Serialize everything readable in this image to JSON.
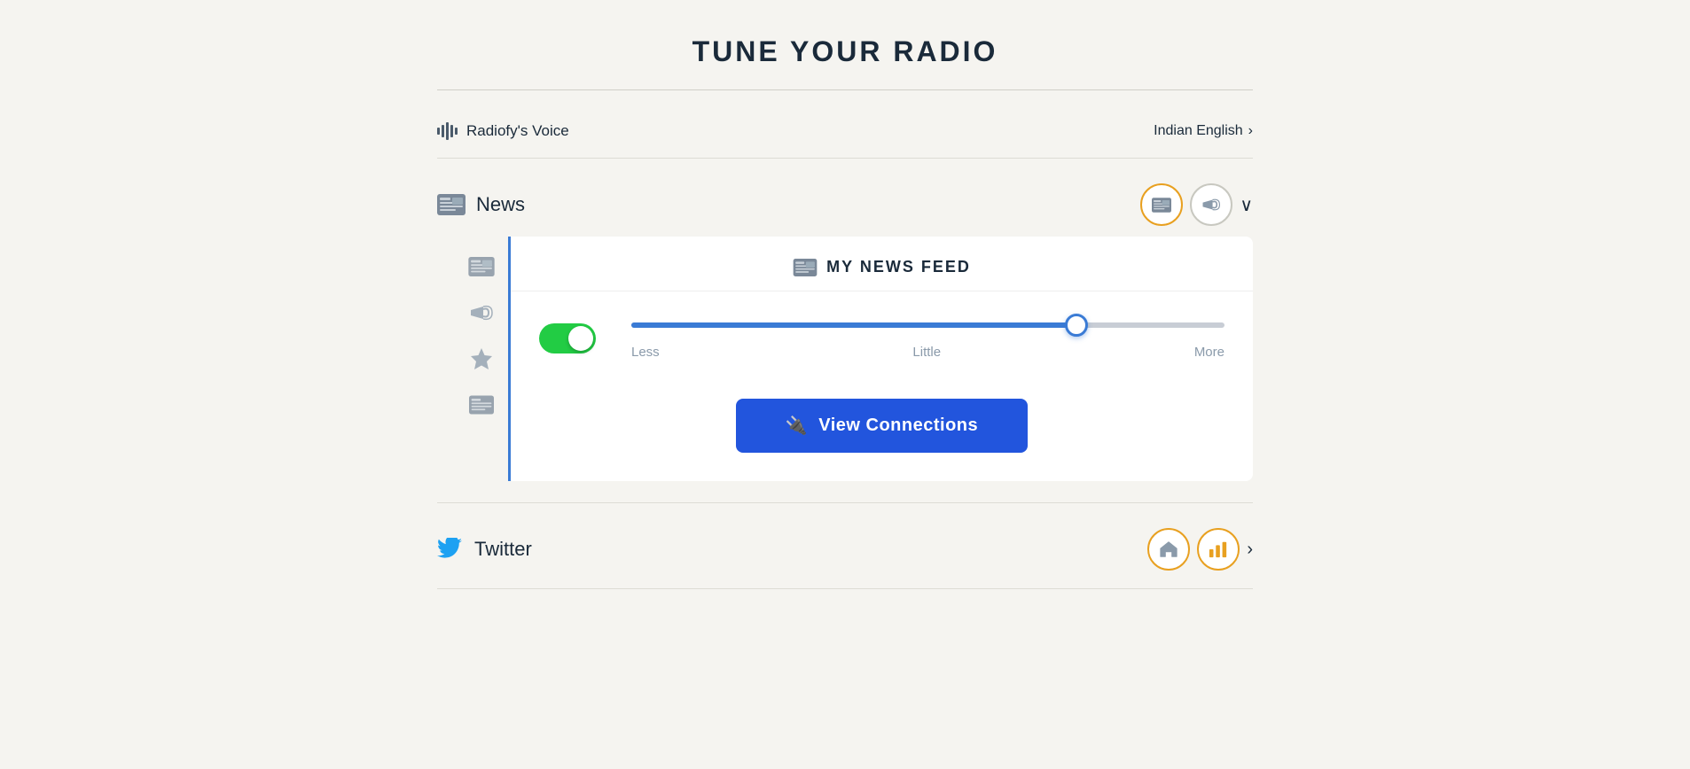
{
  "page": {
    "title": "TUNE YOUR RADIO"
  },
  "voice": {
    "label": "Radiofy's Voice",
    "language": "Indian English",
    "chevron": "›"
  },
  "news": {
    "section_label": "News",
    "feed_header": "MY NEWS FEED",
    "toggle_on": true,
    "slider_labels": {
      "less": "Less",
      "little": "Little",
      "more": "More"
    },
    "slider_value": 75,
    "view_connections_btn": "View Connections"
  },
  "twitter": {
    "section_label": "Twitter"
  },
  "icons": {
    "plug": "⚡",
    "chevron_right": "›",
    "chevron_down": "∨"
  }
}
